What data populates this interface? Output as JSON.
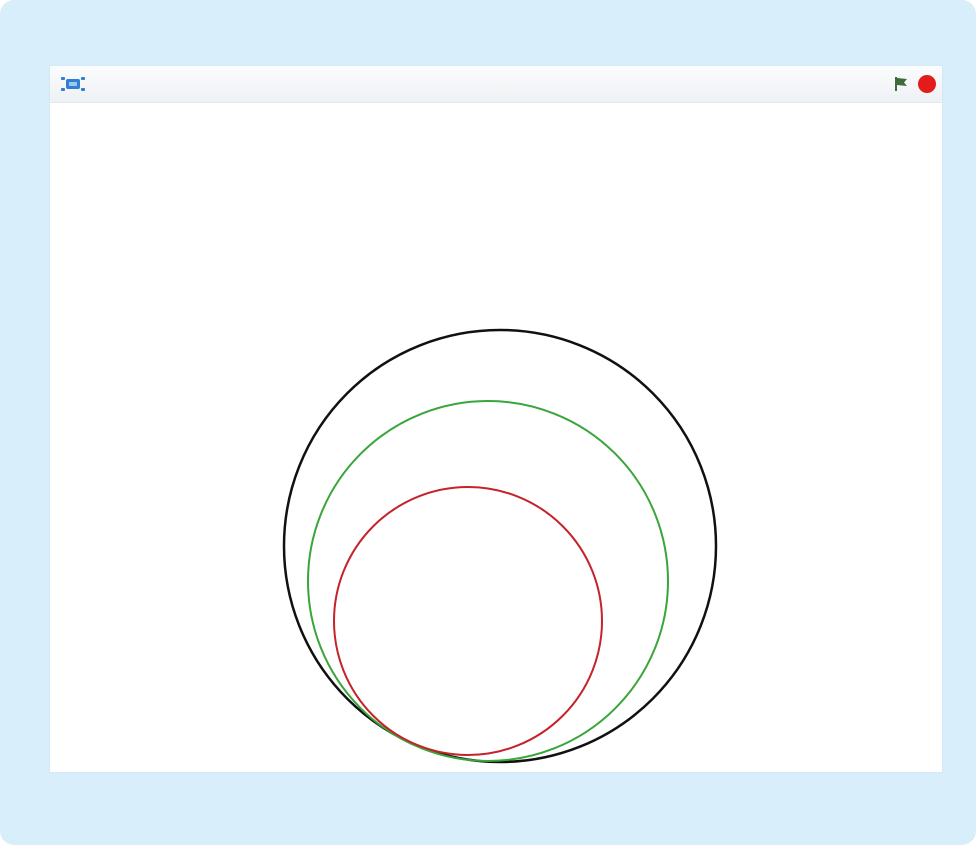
{
  "toolbar": {
    "left_icon": "turbo-mode-icon",
    "green_flag_icon": "green-flag-icon",
    "stop_icon": "stop-sign-icon",
    "flag_color": "#3d6b3a",
    "stop_color": "#e41b1b",
    "accent_color": "#2f7fd2"
  },
  "stage": {
    "background": "#ffffff",
    "circles": [
      {
        "name": "outer-circle",
        "color": "#111111"
      },
      {
        "name": "middle-circle",
        "color": "#3aa53a"
      },
      {
        "name": "inner-circle",
        "color": "#c4232a"
      }
    ]
  }
}
